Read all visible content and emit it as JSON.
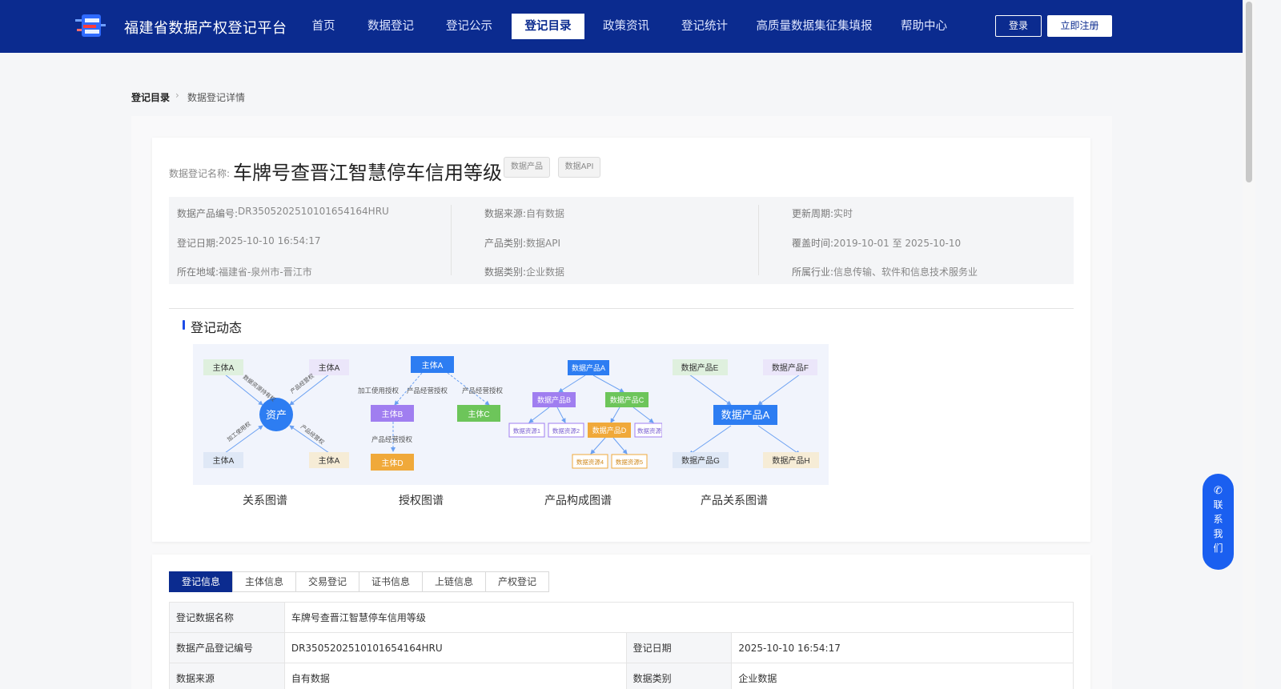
{
  "header": {
    "site_name": "福建省数据产权登记平台",
    "nav": [
      "首页",
      "数据登记",
      "登记公示",
      "登记目录",
      "政策资讯",
      "登记统计",
      "高质量数据集征集填报",
      "帮助中心"
    ],
    "active_nav": "登记目录",
    "login": "登录",
    "register": "立即注册",
    "logo_icon": "platform-logo-icon"
  },
  "breadcrumb": {
    "root": "登记目录",
    "current": "数据登记详情"
  },
  "record": {
    "name_label": "数据登记名称:",
    "title": "车牌号查晋江智慧停车信用等级",
    "tags": [
      "数据产品",
      "数据API"
    ],
    "fields": [
      {
        "label": "数据产品编号:",
        "value": "DR3505202510101654164HRU"
      },
      {
        "label": "登记日期:",
        "value": "2025-10-10 16:54:17"
      },
      {
        "label": "所在地域:",
        "value": "福建省-泉州市-晋江市"
      },
      {
        "label": "数据来源:",
        "value": "自有数据"
      },
      {
        "label": "产品类别:",
        "value": "数据API"
      },
      {
        "label": "数据类别:",
        "value": "企业数据"
      },
      {
        "label": "更新周期:",
        "value": "实时"
      },
      {
        "label": "覆盖时间:",
        "value": "2019-10-01 至 2025-10-10"
      },
      {
        "label": "所属行业:",
        "value": "信息传输、软件和信息技术服务业"
      }
    ]
  },
  "dynamics": {
    "title": "登记动态",
    "captions": [
      "关系图谱",
      "授权图谱",
      "产品构成图谱",
      "产品关系图谱"
    ],
    "graph1": {
      "center": "资产",
      "nodes": [
        "主体A",
        "主体A",
        "主体A",
        "主体A"
      ],
      "edges": [
        "数据资源持有权",
        "产品经营权",
        "加工使用权",
        "产品经营权"
      ]
    },
    "graph2": {
      "nodes": [
        "主体A",
        "主体B",
        "主体C",
        "主体D"
      ],
      "edges": [
        "加工使用授权",
        "产品经营授权",
        "产品经营授权",
        "产品经营授权"
      ]
    },
    "graph3": {
      "nodes": [
        "数据产品A",
        "数据产品B",
        "数据产品C",
        "数据资源1",
        "数据资源2",
        "数据产品D",
        "数据资源",
        "数据资源4",
        "数据资源5"
      ]
    },
    "graph4": {
      "center": "数据产品A",
      "nodes": [
        "数据产品E",
        "数据产品F",
        "数据产品G",
        "数据产品H"
      ]
    }
  },
  "tabs": [
    "登记信息",
    "主体信息",
    "交易登记",
    "证书信息",
    "上链信息",
    "产权登记"
  ],
  "table": {
    "rows": [
      {
        "k1": "登记数据名称",
        "v1": "车牌号查晋江智慧停车信用等级"
      },
      {
        "k1": "数据产品登记编号",
        "v1": "DR3505202510101654164HRU",
        "k2": "登记日期",
        "v2": "2025-10-10 16:54:17"
      },
      {
        "k1": "数据来源",
        "v1": "自有数据",
        "k2": "数据类别",
        "v2": "企业数据"
      }
    ]
  },
  "contact": {
    "icon": "phone-icon",
    "label": "联系我们",
    "chars": [
      "联",
      "系",
      "我",
      "们"
    ]
  },
  "colors": {
    "brand": "#0b2b8f",
    "accent": "#1a5ff0"
  }
}
